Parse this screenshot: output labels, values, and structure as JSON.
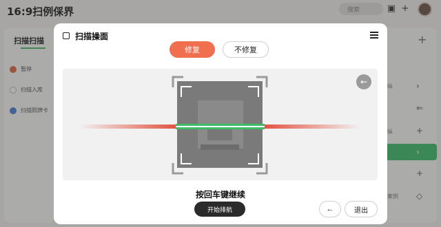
{
  "background": {
    "title": "16:9扫例倸界",
    "search_placeholder": "搜索",
    "panel_tab": "扫描扫描",
    "side_items": [
      {
        "label": "暂停",
        "color": "#e2683f"
      },
      {
        "label": "扫描入库",
        "color": "#bcbcbc"
      },
      {
        "label": "扫描照牌卡",
        "color": "#4a7fd6"
      }
    ],
    "right_texts": [
      "纵",
      "纵",
      "案例"
    ]
  },
  "dialog": {
    "title": "扫描操面",
    "repair_label": "修复",
    "no_repair_label": "不修复",
    "prompt": "按回车键继续",
    "start_button": "开始排航",
    "exit_button": "退出",
    "back_icon": "←"
  },
  "colors": {
    "accent": "#ef6f4f",
    "scan_green": "#3dbd6a",
    "laser_red": "#e24b38",
    "dark_button": "#2b2b2b"
  }
}
